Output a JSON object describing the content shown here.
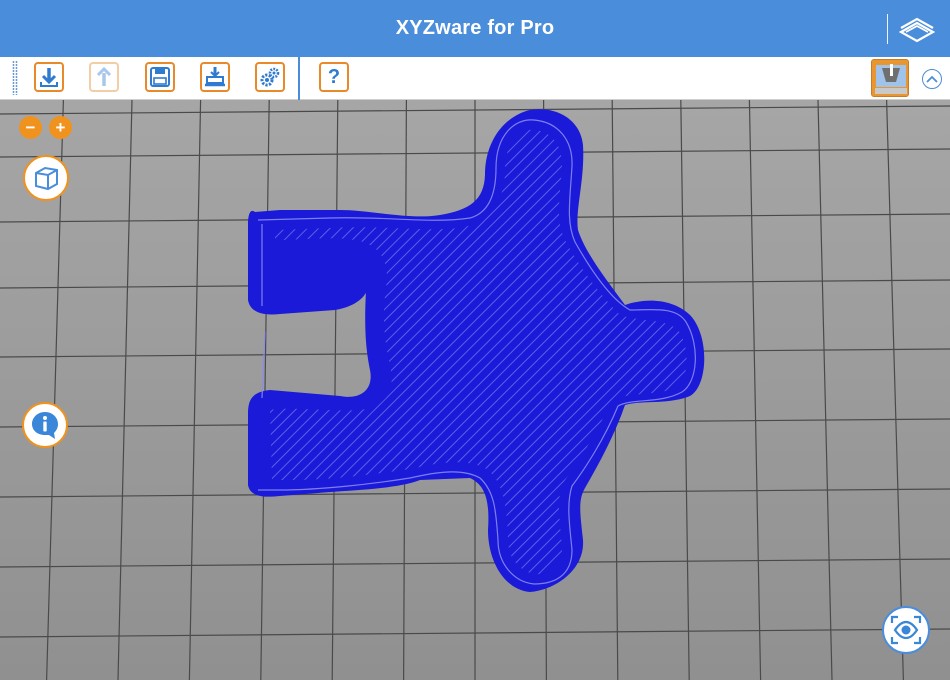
{
  "window": {
    "title": "XYZware for Pro"
  },
  "toolbar": {
    "import_icon": "import-arrow-icon",
    "export_icon": "export-arrow-icon",
    "save_icon": "floppy-disk-icon",
    "print_icon": "print-to-printer-icon",
    "settings_icon": "gears-icon",
    "help_label": "?",
    "printer_icon": "printer-status-icon",
    "collapse_icon": "chevron-up-icon"
  },
  "viewport": {
    "zoom_out_label": "−",
    "zoom_in_label": "+",
    "view_cube_icon": "cube-icon",
    "info_icon": "info-icon",
    "eye_icon": "eye-view-icon",
    "model_color": "#1a1ad8"
  },
  "colors": {
    "brand": "#4a8ddb",
    "accent": "#f0921e",
    "grid_background": "#9a9a9a",
    "model": "#1a1ad8"
  }
}
